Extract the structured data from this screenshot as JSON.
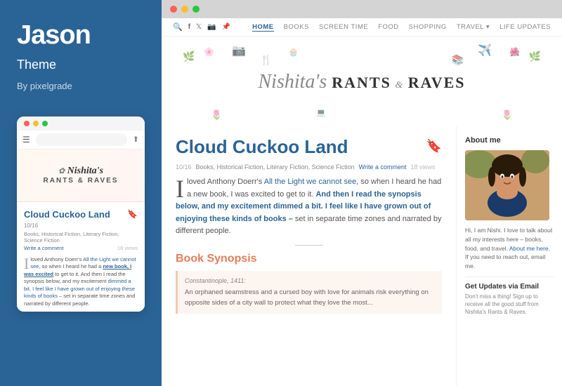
{
  "sidebar": {
    "title": "Jason",
    "subtitle": "Theme",
    "by": "By pixelgrade"
  },
  "mobile": {
    "blog_name": "Nishita's",
    "blog_sub": "RANTS & RAVES",
    "post_title": "Cloud Cuckoo Land",
    "post_date": "10/16",
    "post_categories": "Books, Historical Fiction, Literary Fiction, Science Fiction",
    "post_comment": "Write a comment",
    "post_views": "18 views",
    "post_excerpt": "I loved Anthony Doerr's All the Light we cannot see, so when I heard he had a new book, I was excited to get to it. And then I read the synopsis below, and my excitement dimmed a bit. I feel like I have grown out of enjoying these kinds of books – set in separate time zones and narrated by different people."
  },
  "browser": {
    "nav": {
      "icons": [
        "🔍",
        "f",
        "𝕏",
        "📷",
        "📌"
      ],
      "links": [
        "HOME",
        "BOOKS",
        "SCREEN TIME",
        "FOOD",
        "SHOPPING",
        "TRAVEL",
        "LIFE UPDATES"
      ],
      "active": "HOME"
    },
    "hero": {
      "blog_name": "Nishita's RANTS & RAVES"
    },
    "post": {
      "title": "Cloud Cuckoo Land",
      "date": "10/16",
      "categories": "Books, Historical Fiction, Literary Fiction, Science Fiction",
      "comment_link": "Write a comment",
      "views": "18 views",
      "excerpt_p1": "loved Anthony Doerr's ",
      "excerpt_link1": "All the Light we cannot see",
      "excerpt_p2": ", so when I heard he had a new book, I was excited to get to it. ",
      "excerpt_bold": "And then I read the synopsis below, and my excitement dimmed a bit. I feel like I have grown out of enjoying these kinds of books –",
      "excerpt_p3": " set in separate time zones and narrated by different people."
    },
    "synopsis": {
      "title": "Book Synopsis",
      "location": "Constantinople, 1411:",
      "text": "An orphaned seamstress and a cursed boy with love for animals risk everything on opposite sides of a city wall to protect what they love the most..."
    },
    "sidebar_widget": {
      "title": "About me",
      "text": "Hi, I am Nishi. I love to talk about all my interests here – books, food, and travel.",
      "link_text": "About me here.",
      "contact_text": "If you need to reach out, email me.",
      "subscribe_title": "Get Updates via Email",
      "subscribe_text": "Don't miss a thing! Sign up to receive all the good stuff from Nishita's Rants & Raves."
    }
  }
}
